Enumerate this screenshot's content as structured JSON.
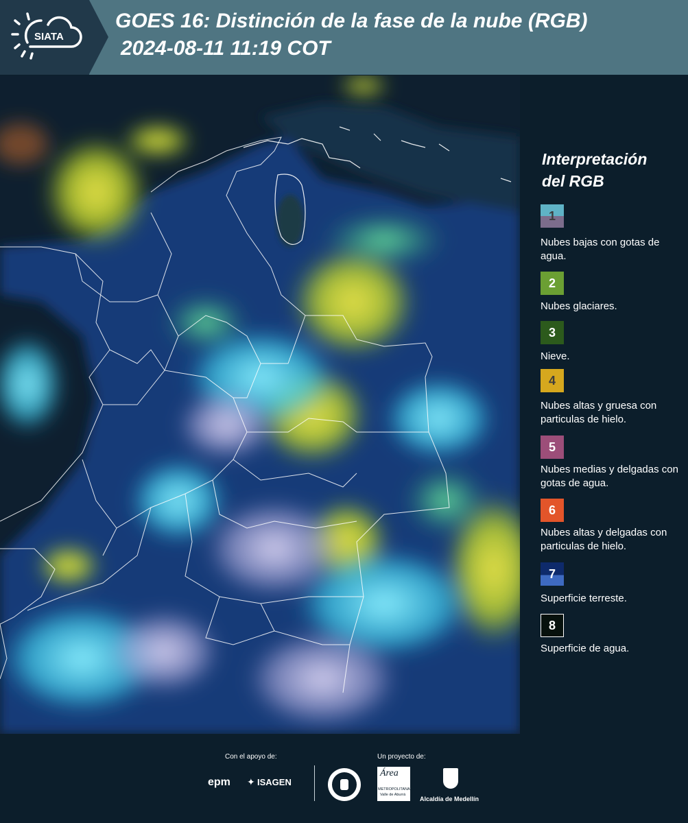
{
  "header": {
    "logo_text": "SIATA",
    "title": "GOES 16: Distinción de la fase de la nube (RGB)",
    "timestamp": "2024-08-11 11:19 COT"
  },
  "map": {
    "type": "satellite RGB composite",
    "region": "Colombia"
  },
  "legend": {
    "title_line1": "Interpretación",
    "title_line2": "del RGB",
    "items": [
      {
        "number": "1",
        "label": "Nubes bajas con gotas de agua.",
        "color_top": "#5fb3c6",
        "color_bottom": "#7c6d8c"
      },
      {
        "number": "2",
        "label": "Nubes glaciares.",
        "color": "#6b9f33"
      },
      {
        "number": "3",
        "label": "Nieve.",
        "color": "#2c5a1c"
      },
      {
        "number": "4",
        "label": "Nubes altas y gruesa con particulas de hielo.",
        "color": "#d6a81e"
      },
      {
        "number": "5",
        "label": "Nubes medias y delgadas con gotas de agua.",
        "color": "#9c4e79"
      },
      {
        "number": "6",
        "label": "Nubes altas y delgadas con particulas de hielo.",
        "color": "#e3552a"
      },
      {
        "number": "7",
        "label": "Superficie terreste.",
        "color_top": "#0e2a6b",
        "color_bottom": "#3e6ac1"
      },
      {
        "number": "8",
        "label": "Superficie de agua.",
        "color": "#07110d"
      }
    ]
  },
  "footer": {
    "support_label": "Con el apoyo de:",
    "project_label": "Un proyecto de:",
    "epm": "epm",
    "isagen": "ISAGEN",
    "area_metro_1": "METROPOLITANA",
    "area_metro_2": "Valle de Aburrá",
    "alcaldia": "Alcaldía de Medellín"
  }
}
